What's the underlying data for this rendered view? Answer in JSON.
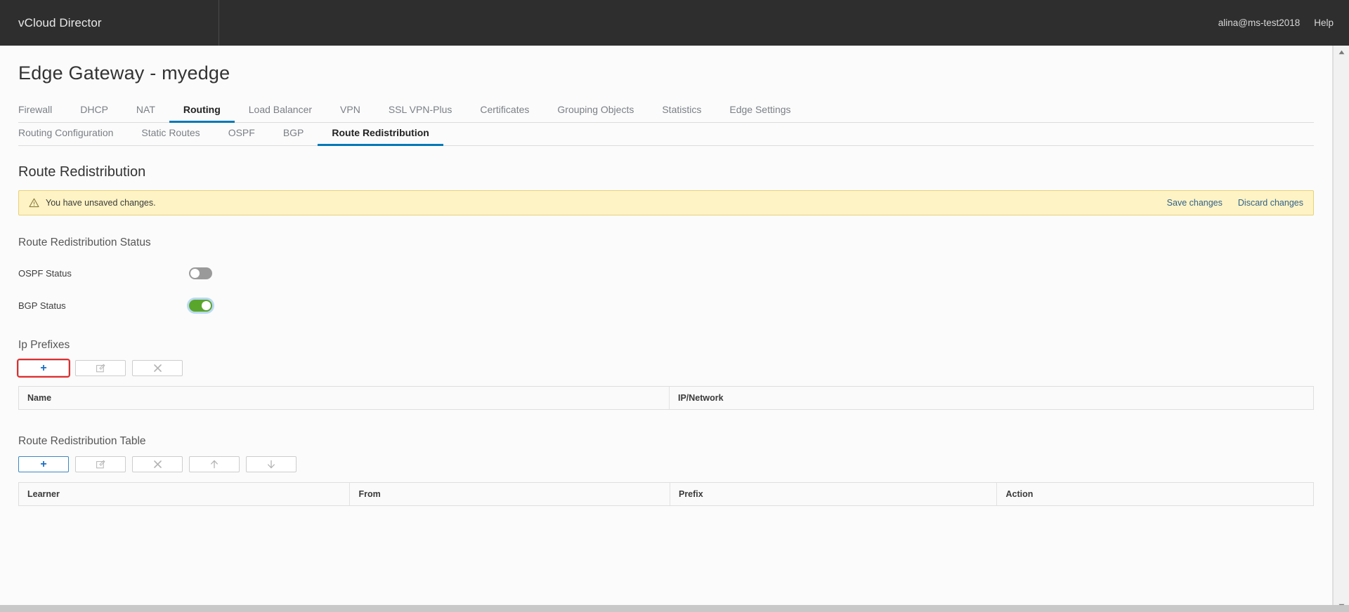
{
  "header": {
    "brand": "vCloud Director",
    "user": "alina@ms-test2018",
    "help": "Help"
  },
  "page": {
    "title": "Edge Gateway - myedge"
  },
  "primary_tabs": [
    {
      "label": "Firewall",
      "active": false
    },
    {
      "label": "DHCP",
      "active": false
    },
    {
      "label": "NAT",
      "active": false
    },
    {
      "label": "Routing",
      "active": true
    },
    {
      "label": "Load Balancer",
      "active": false
    },
    {
      "label": "VPN",
      "active": false
    },
    {
      "label": "SSL VPN-Plus",
      "active": false
    },
    {
      "label": "Certificates",
      "active": false
    },
    {
      "label": "Grouping Objects",
      "active": false
    },
    {
      "label": "Statistics",
      "active": false
    },
    {
      "label": "Edge Settings",
      "active": false
    }
  ],
  "secondary_tabs": [
    {
      "label": "Routing Configuration",
      "active": false
    },
    {
      "label": "Static Routes",
      "active": false
    },
    {
      "label": "OSPF",
      "active": false
    },
    {
      "label": "BGP",
      "active": false
    },
    {
      "label": "Route Redistribution",
      "active": true
    }
  ],
  "section": {
    "title": "Route Redistribution"
  },
  "alert": {
    "icon": "warning-triangle-icon",
    "text": "You have unsaved changes.",
    "save_label": "Save changes",
    "discard_label": "Discard changes"
  },
  "status": {
    "heading": "Route Redistribution Status",
    "rows": [
      {
        "label": "OSPF Status",
        "value": "off"
      },
      {
        "label": "BGP Status",
        "value": "on"
      }
    ]
  },
  "ip_prefixes": {
    "heading": "Ip Prefixes",
    "toolbar": [
      {
        "icon": "plus-icon",
        "name": "add-ip-prefix-button",
        "state": "highlight-red"
      },
      {
        "icon": "edit-icon",
        "name": "edit-ip-prefix-button",
        "state": "disabled"
      },
      {
        "icon": "delete-icon",
        "name": "delete-ip-prefix-button",
        "state": "disabled"
      }
    ],
    "columns": [
      "Name",
      "IP/Network"
    ],
    "rows": []
  },
  "redistribution_table": {
    "heading": "Route Redistribution Table",
    "toolbar": [
      {
        "icon": "plus-icon",
        "name": "add-rule-button",
        "state": "focused-blue"
      },
      {
        "icon": "edit-icon",
        "name": "edit-rule-button",
        "state": "disabled"
      },
      {
        "icon": "delete-icon",
        "name": "delete-rule-button",
        "state": "disabled"
      },
      {
        "icon": "arrow-up-icon",
        "name": "move-rule-up-button",
        "state": "disabled"
      },
      {
        "icon": "arrow-down-icon",
        "name": "move-rule-down-button",
        "state": "disabled"
      }
    ],
    "columns": [
      "Learner",
      "From",
      "Prefix",
      "Action"
    ],
    "rows": []
  },
  "colors": {
    "header_bg": "#2e2e2e",
    "accent": "#0079b8",
    "link": "#31618c",
    "alert_bg": "#fdf3c4",
    "alert_border": "#e8d17c",
    "toggle_on": "#5aa52b",
    "toggle_off": "#9a9a9a",
    "highlight_red": "#e52b2b"
  }
}
